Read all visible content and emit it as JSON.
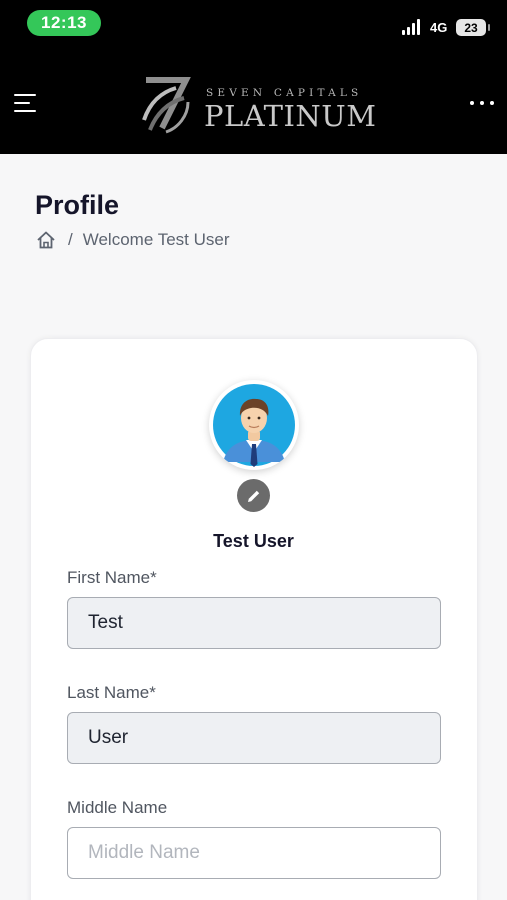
{
  "status_bar": {
    "time": "12:13",
    "network": "4G",
    "battery": "23",
    "pill_color": "#34c759"
  },
  "header": {
    "brand_top": "SEVEN CAPITALS",
    "brand_main": "PLATINUM",
    "menu_icon": "hamburger-menu-icon",
    "more_icon": "more-horizontal-icon"
  },
  "page": {
    "title": "Profile",
    "breadcrumb": {
      "home_icon": "home-icon",
      "separator": "/",
      "current": "Welcome Test User"
    }
  },
  "profile": {
    "display_name": "Test User",
    "edit_icon": "pencil-icon"
  },
  "form": {
    "first_name": {
      "label": "First Name*",
      "value": "Test"
    },
    "last_name": {
      "label": "Last Name*",
      "value": "User"
    },
    "middle_name": {
      "label": "Middle Name",
      "value": "",
      "placeholder": "Middle Name"
    }
  }
}
